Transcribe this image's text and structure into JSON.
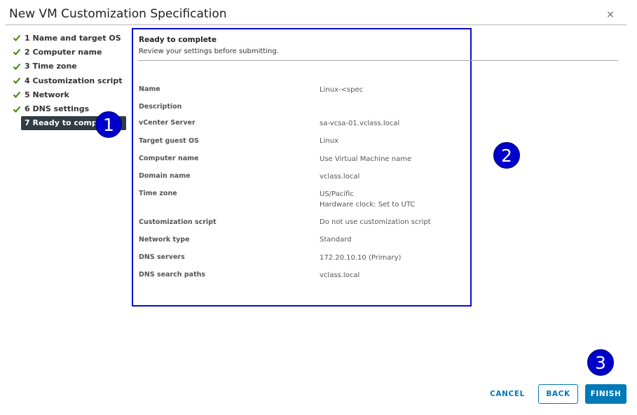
{
  "dialog": {
    "title": "New VM Customization Specification",
    "close": "×"
  },
  "steps": [
    {
      "label": "1 Name and target OS",
      "done": true
    },
    {
      "label": "2 Computer name",
      "done": true
    },
    {
      "label": "3 Time zone",
      "done": true
    },
    {
      "label": "4 Customization script",
      "done": true
    },
    {
      "label": "5 Network",
      "done": true
    },
    {
      "label": "6 DNS settings",
      "done": true
    },
    {
      "label": "7 Ready to complete",
      "done": false,
      "active": true
    }
  ],
  "callouts": {
    "one": "1",
    "two": "2",
    "three": "3"
  },
  "review": {
    "title": "Ready to complete",
    "subtitle": "Review your settings before submitting.",
    "rows": [
      {
        "label": "Name",
        "value": "Linux-<spec"
      },
      {
        "label": "Description",
        "value": ""
      },
      {
        "label": "vCenter Server",
        "value": "sa-vcsa-01.vclass.local"
      },
      {
        "label": "Target guest OS",
        "value": "Linux"
      },
      {
        "label": "Computer name",
        "value": "Use Virtual Machine name"
      },
      {
        "label": "Domain name",
        "value": "vclass.local"
      },
      {
        "label": "Time zone",
        "value": "US/Pacific",
        "value2": "Hardware clock: Set to UTC"
      },
      {
        "label": "Customization script",
        "value": "Do not use customization script"
      },
      {
        "label": "Network type",
        "value": "Standard"
      },
      {
        "label": "DNS servers",
        "value": "172.20.10.10 (Primary)"
      },
      {
        "label": "DNS search paths",
        "value": "vclass.local"
      }
    ]
  },
  "buttons": {
    "cancel": "CANCEL",
    "back": "BACK",
    "finish": "FINISH"
  },
  "colors": {
    "accent": "#0079b8",
    "check": "#3c8500",
    "active_step_bg": "#313c45",
    "callout": "#0000cc"
  }
}
